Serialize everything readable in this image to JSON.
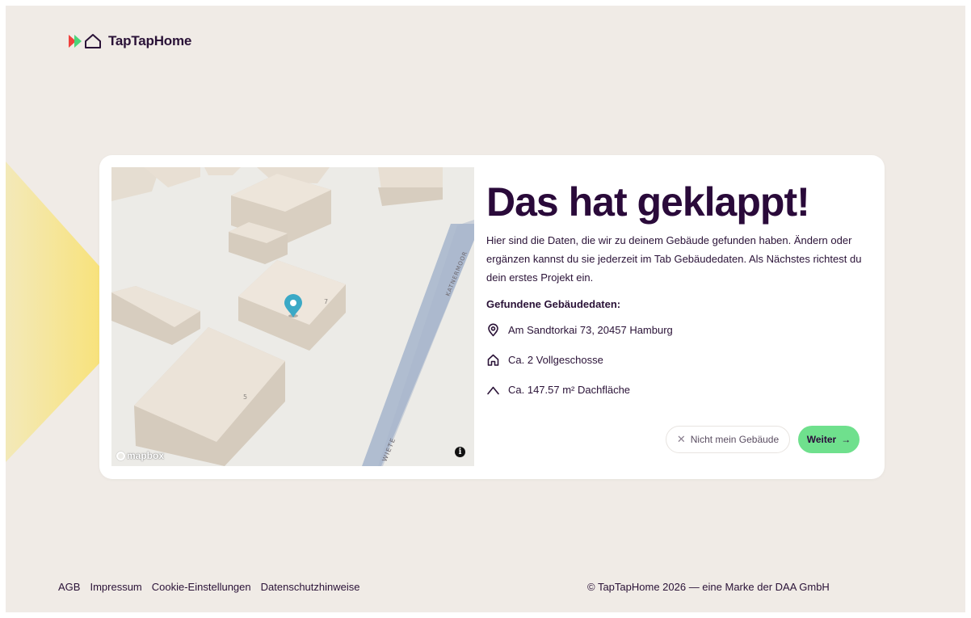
{
  "brand": {
    "name": "TapTapHome"
  },
  "map": {
    "street_labels": [
      "KATNERMOOR",
      "WIETE"
    ],
    "building_numbers": [
      "7",
      "5"
    ],
    "attribution_logo": "mapbox",
    "info_button": "i"
  },
  "main": {
    "title": "Das hat geklappt!",
    "description": "Hier sind die Daten, die wir zu deinem Gebäude gefunden haben. Ändern oder ergänzen kannst du sie jederzeit im Tab Gebäudedaten. Als Nächstes richtest du dein erstes Projekt ein.",
    "found_label": "Gefundene Gebäudedaten:",
    "details": [
      {
        "icon": "location-pin-icon",
        "text": "Am Sandtorkai 73, 20457 Hamburg"
      },
      {
        "icon": "house-icon",
        "text": "Ca. 2 Vollgeschosse"
      },
      {
        "icon": "roof-icon",
        "text": "Ca. 147.57 m² Dachfläche"
      }
    ],
    "secondary_button": "Nicht mein Gebäude",
    "primary_button": "Weiter"
  },
  "footer": {
    "links": [
      "AGB",
      "Impressum",
      "Cookie-Einstellungen",
      "Datenschutzhinweise"
    ],
    "copyright": "© TapTapHome 2026 — eine Marke der DAA GmbH"
  },
  "colors": {
    "background": "#f0ebe6",
    "text_dark": "#2a0a3a",
    "primary_button": "#6fe08d",
    "map_marker": "#3ba9c6",
    "logo_red": "#f0403c",
    "logo_green": "#4cd57a"
  }
}
